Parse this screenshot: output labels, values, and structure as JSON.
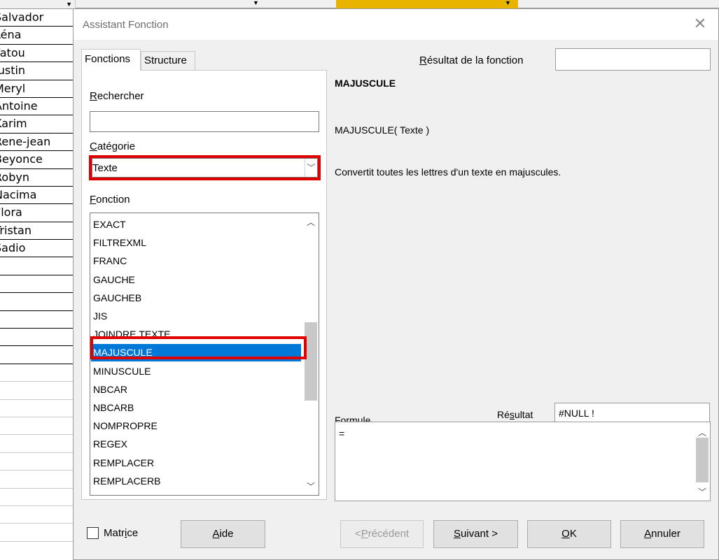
{
  "sheet": {
    "names": [
      "Salvador",
      "Léna",
      "Fatou",
      "Justin",
      "Meryl",
      "Antoine",
      "Karim",
      "Rene-jean",
      "Beyonce",
      "Robyn",
      "Nacima",
      "Flora",
      "Tristan",
      "Sadio"
    ]
  },
  "dialog": {
    "title": "Assistant Fonction",
    "close_icon": "close-icon",
    "tabs": [
      {
        "label": "Fonctions",
        "active": true
      },
      {
        "label": "Structure",
        "active": false
      }
    ],
    "search": {
      "label_first": "R",
      "label_rest": "echercher",
      "value": ""
    },
    "category": {
      "label_first": "C",
      "label_rest": "atégorie",
      "value": "Texte"
    },
    "function_list": {
      "label_first": "F",
      "label_rest": "onction",
      "items": [
        "EXACT",
        "FILTREXML",
        "FRANC",
        "GAUCHE",
        "GAUCHEB",
        "JIS",
        "JOINDRE.TEXTE",
        "MAJUSCULE",
        "MINUSCULE",
        "NBCAR",
        "NBCARB",
        "NOMPROPRE",
        "REGEX",
        "REMPLACER",
        "REMPLACERB"
      ],
      "selected": "MAJUSCULE"
    },
    "function_result": {
      "label_first": "R",
      "label_rest": "ésultat de la fonction",
      "value": ""
    },
    "info": {
      "name": "MAJUSCULE",
      "syntax": "MAJUSCULE( Texte )",
      "description": "Convertit toutes les lettres d'un texte en majuscules."
    },
    "formula": {
      "label_pre": "For",
      "label_ul": "m",
      "label_post": "ule",
      "value": "="
    },
    "result": {
      "label_pre": "Ré",
      "label_ul": "s",
      "label_post": "ultat",
      "value": "#NULL !"
    },
    "footer": {
      "matrice": {
        "label_pre": "Matr",
        "label_ul": "i",
        "label_post": "ce",
        "checked": false
      },
      "aide": {
        "label_ul": "A",
        "label_post": "ide"
      },
      "precedent": {
        "label_pre": "<",
        "label_ul": "P",
        "label_post": "récédent"
      },
      "suivant": {
        "label_ul": "S",
        "label_post": "uivant >"
      },
      "ok": {
        "label_ul": "O",
        "label_post": "K"
      },
      "annuler": {
        "label_ul": "A",
        "label_post": "nnuler"
      }
    }
  },
  "colors": {
    "selection": "#0078d7",
    "highlight_box": "#e00000",
    "header_yellow": "#e8b400"
  }
}
